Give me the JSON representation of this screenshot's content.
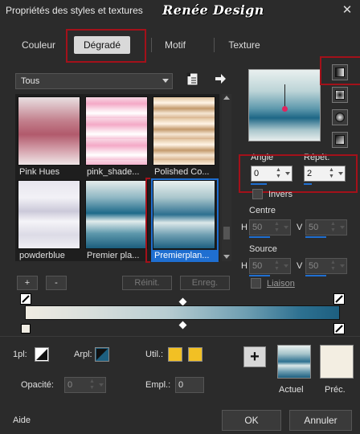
{
  "window": {
    "title": "Propriétés des styles et textures",
    "logo_text": "Renée Design",
    "close_glyph": "✕"
  },
  "tabs": [
    {
      "label": "Couleur"
    },
    {
      "label": "Dégradé",
      "active": true
    },
    {
      "label": "Motif"
    },
    {
      "label": "Texture"
    }
  ],
  "library": {
    "category": "Tous",
    "thumbnails": [
      {
        "label": "Pink Hues"
      },
      {
        "label": "pink_shade..."
      },
      {
        "label": "Polished Co..."
      },
      {
        "label": "powderblue"
      },
      {
        "label": "Premier pla..."
      },
      {
        "label": "Premierplan...",
        "selected": true
      }
    ],
    "add_label": "+",
    "remove_label": "-",
    "reset_label": "Réinit.",
    "save_label": "Enreg."
  },
  "gradient": {
    "angle_label": "Angle",
    "angle_value": "0",
    "repeat_label": "Répét.",
    "repeat_value": "2",
    "invert_label": "Invers",
    "center_label": "Centre",
    "center_h_label": "H",
    "center_h_value": "50",
    "center_v_label": "V",
    "center_v_value": "50",
    "source_label": "Source",
    "source_h_label": "H",
    "source_h_value": "50",
    "source_v_label": "V",
    "source_v_value": "50",
    "link_label": "Liaison"
  },
  "stops": {
    "opl_label": "1pl:",
    "arpl_label": "Arpl:",
    "util_label": "Util.:",
    "opacity_label": "Opacité:",
    "opacity_value": "0",
    "empl_label": "Empl.:",
    "empl_value": "0",
    "util_color": "#f2c024"
  },
  "compare": {
    "current_label": "Actuel",
    "previous_label": "Préc."
  },
  "footer": {
    "help_label": "Aide",
    "ok_label": "OK",
    "cancel_label": "Annuler"
  },
  "colors": {
    "highlight_red": "#a3111a",
    "selection_blue": "#1f6fd1"
  }
}
